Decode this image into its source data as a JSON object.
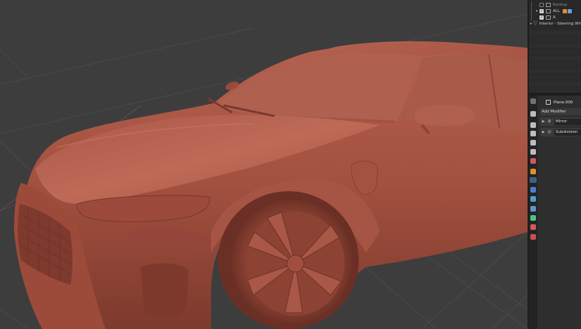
{
  "outliner": {
    "rows": [
      {
        "label": "Backup",
        "checked": false,
        "dim": true
      },
      {
        "label": "ALL",
        "checked": true,
        "dim": false
      },
      {
        "label": "A",
        "checked": true,
        "dim": false
      }
    ],
    "object_row": {
      "label": "Interior - Steering Wh"
    }
  },
  "properties": {
    "object_name": "Plane.000",
    "add_modifier_label": "Add Modifier",
    "modifiers": [
      {
        "name": "Mirror",
        "icon": "mirror-icon"
      },
      {
        "name": "Subdivision",
        "icon": "subdivision-icon"
      }
    ],
    "tabs": [
      {
        "icon": "tool-icon",
        "color": "#bdbdbd"
      },
      {
        "icon": "render-icon",
        "color": "#bdbdbd"
      },
      {
        "icon": "output-icon",
        "color": "#bdbdbd"
      },
      {
        "icon": "view-layer-icon",
        "color": "#bdbdbd"
      },
      {
        "icon": "scene-icon",
        "color": "#d07a7a"
      },
      {
        "icon": "world-icon",
        "color": "#d05a5a"
      },
      {
        "icon": "object-icon",
        "color": "#e0902a"
      },
      {
        "icon": "modifier-icon",
        "color": "#5b8fd6",
        "active": true
      },
      {
        "icon": "particles-icon",
        "color": "#4a7fd0"
      },
      {
        "icon": "physics-icon",
        "color": "#4a9fd0"
      },
      {
        "icon": "constraints-icon",
        "color": "#6a8fd0"
      },
      {
        "icon": "data-icon",
        "color": "#4cc38a"
      },
      {
        "icon": "material-icon",
        "color": "#d05a5a"
      },
      {
        "icon": "texture-icon",
        "color": "#c85050"
      }
    ]
  },
  "colors": {
    "viewport_bg": "#3d3d3d",
    "clay": "#b45a4a",
    "panel_bg": "#2e2e2e"
  }
}
